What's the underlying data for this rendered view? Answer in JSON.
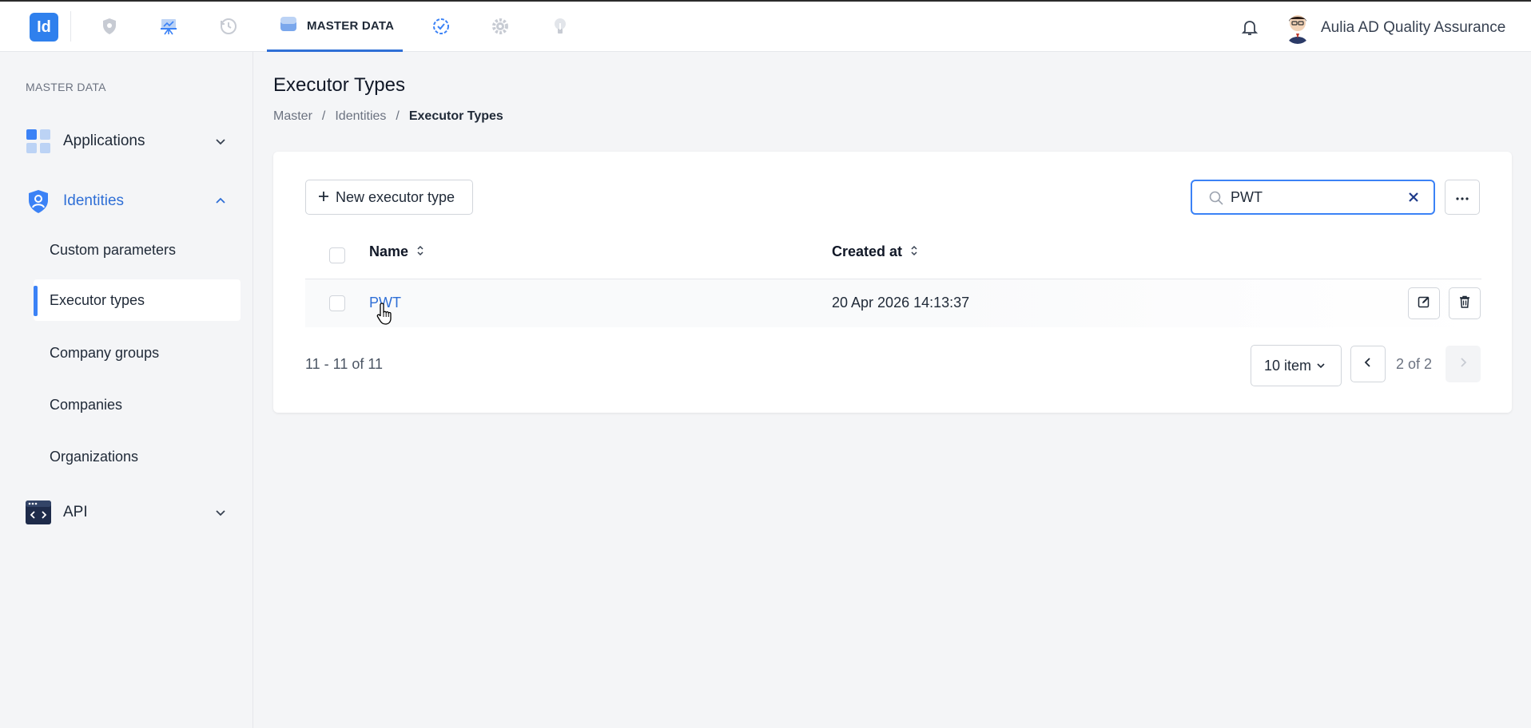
{
  "topbar": {
    "logo_text": "Id",
    "active_tab_label": "MASTER DATA",
    "user_name": "Aulia AD Quality Assurance",
    "nav_icons": [
      "shield-icon",
      "presentation-icon",
      "history-icon",
      "database-icon",
      "check-circle-icon",
      "gear-icon",
      "lightbulb-icon"
    ]
  },
  "sidebar": {
    "title": "MASTER DATA",
    "groups": {
      "applications": "Applications",
      "identities": "Identities",
      "api": "API"
    },
    "items": [
      "Custom parameters",
      "Executor types",
      "Company groups",
      "Companies",
      "Organizations"
    ]
  },
  "main": {
    "title": "Executor Types",
    "breadcrumb": [
      "Master",
      "/",
      "Identities",
      "/",
      "Executor Types"
    ],
    "new_button_label": "New executor type",
    "search_value": "PWT",
    "columns": [
      "Name",
      "Created at"
    ],
    "rows": [
      {
        "name": "PWT",
        "created_at": "20 Apr 2026 14:13:37"
      }
    ],
    "range_text": "11 - 11 of 11",
    "page_size": "10 item",
    "page_indicator": "2 of 2"
  },
  "colors": {
    "accent": "#2f6fd6",
    "logo_bg": "#2f80ed",
    "page_bg": "#f4f5f7"
  }
}
